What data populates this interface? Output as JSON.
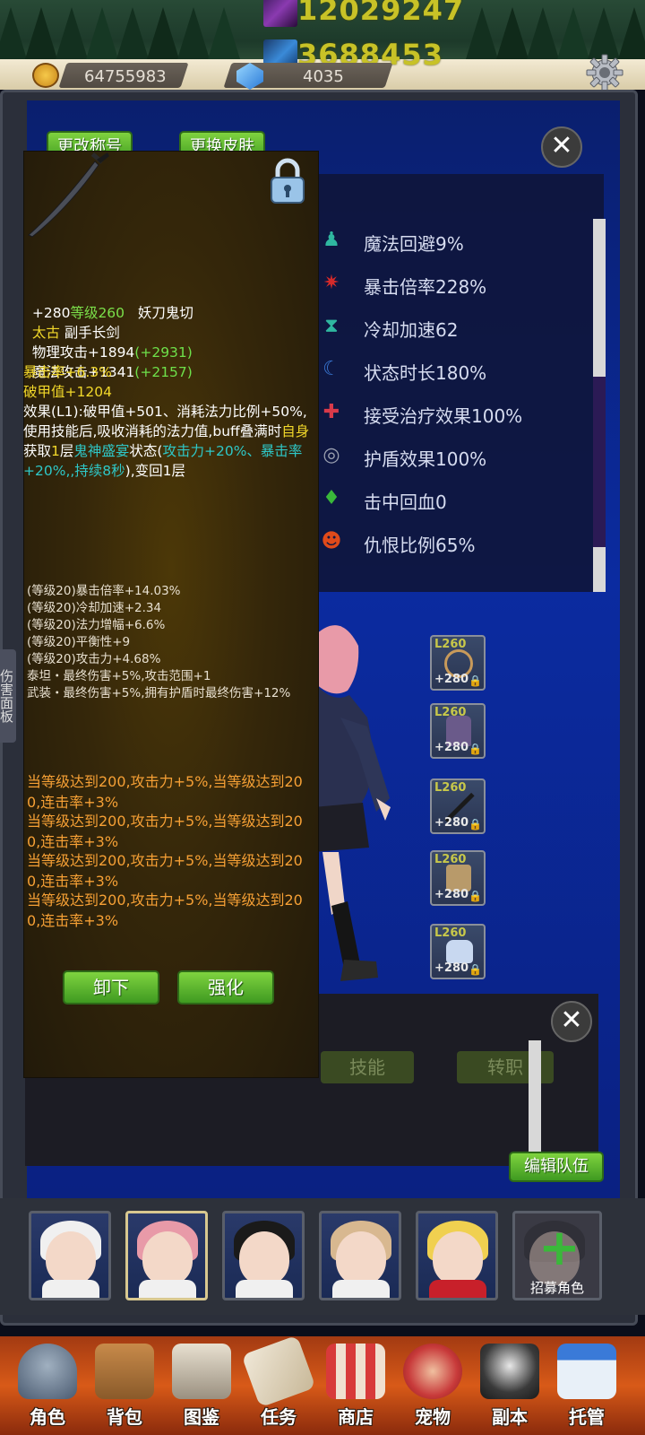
{
  "header": {
    "power_value": "12029247",
    "power2_value": "3688453",
    "gold_amount": "64755983",
    "gem_amount": "4035"
  },
  "main": {
    "rename_button": "更改称号",
    "skin_button": "更换皮肤",
    "close_label": "✕",
    "team_button": "编辑队伍"
  },
  "stats": [
    {
      "label": "魔法回避9%",
      "icon": "mage-icon",
      "color": "#2fb7a0"
    },
    {
      "label": "暴击倍率228%",
      "icon": "crit-icon",
      "color": "#d42a2a"
    },
    {
      "label": "冷却加速62",
      "icon": "hourglass-icon",
      "color": "#2fb7a0"
    },
    {
      "label": "状态时长180%",
      "icon": "duration-icon",
      "color": "#3a7ad8"
    },
    {
      "label": "接受治疗效果100%",
      "icon": "heal-cross-icon",
      "color": "#d83a4a"
    },
    {
      "label": "护盾效果100%",
      "icon": "shield-ring-icon",
      "color": "#9aa0b0"
    },
    {
      "label": "击中回血0",
      "icon": "blood-drop-icon",
      "color": "#3ab83a"
    },
    {
      "label": "仇恨比例65%",
      "icon": "demon-icon",
      "color": "#e04a1a"
    }
  ],
  "equipment": [
    {
      "level": "L260",
      "plus": "+280"
    },
    {
      "level": "L260",
      "plus": "+280"
    },
    {
      "level": "L260",
      "plus": "+280"
    },
    {
      "level": "L260",
      "plus": "+280"
    },
    {
      "level": "L260",
      "plus": "+280"
    }
  ],
  "lower": {
    "tab_skill": "技能",
    "tab_class": "转职"
  },
  "side_tab": "伤害面板",
  "tooltip": {
    "plus": "+280",
    "level": "等级260",
    "name": "妖刀鬼切",
    "rarity": "太古",
    "type": " 副手长剑",
    "phys_label": "物理攻击+1894",
    "phys_bonus": "(+2931)",
    "mag_label": "魔法攻击+1341",
    "mag_bonus": "(+2157)",
    "crit": "暴击率+6.3%",
    "armor": "破甲值+1204",
    "effect_1": "效果(L1):破甲值+501、消耗法力比例+50%,使用技能后,吸收消耗的法力值,buff叠满时",
    "effect_self": "自身",
    "effect_2": "获取",
    "effect_num": "1",
    "effect_3": "层",
    "effect_buff": "鬼神盛宴",
    "effect_4": "状态(",
    "effect_green": "攻击力+20%、暴击率+20%,,持续8秒",
    "effect_5": "),变回1层",
    "sub_stats": [
      "(等级20)暴击倍率+14.03%",
      "(等级20)冷却加速+2.34",
      "(等级20)法力增幅+6.6%",
      "(等级20)平衡性+9",
      "(等级20)攻击力+4.68%",
      "泰坦・最终伤害+5%,攻击范围+1",
      "武装・最终伤害+5%,拥有护盾时最终伤害+12%"
    ],
    "set_bonus": [
      "当等级达到200,攻击力+5%,当等级达到200,连击率+3%",
      "当等级达到200,攻击力+5%,当等级达到200,连击率+3%",
      "当等级达到200,攻击力+5%,当等级达到200,连击率+3%",
      "当等级达到200,攻击力+5%,当等级达到200,连击率+3%"
    ],
    "unequip_button": "卸下",
    "enhance_button": "强化"
  },
  "roster": {
    "recruit_label": "招募角色"
  },
  "nav": [
    {
      "label": "角色",
      "icon": "helmet-icon"
    },
    {
      "label": "背包",
      "icon": "backpack-icon"
    },
    {
      "label": "图鉴",
      "icon": "book-icon"
    },
    {
      "label": "任务",
      "icon": "scroll-icon"
    },
    {
      "label": "商店",
      "icon": "shop-icon"
    },
    {
      "label": "宠物",
      "icon": "meat-icon"
    },
    {
      "label": "副本",
      "icon": "skull-icon"
    },
    {
      "label": "托管",
      "icon": "calendar-icon"
    }
  ]
}
